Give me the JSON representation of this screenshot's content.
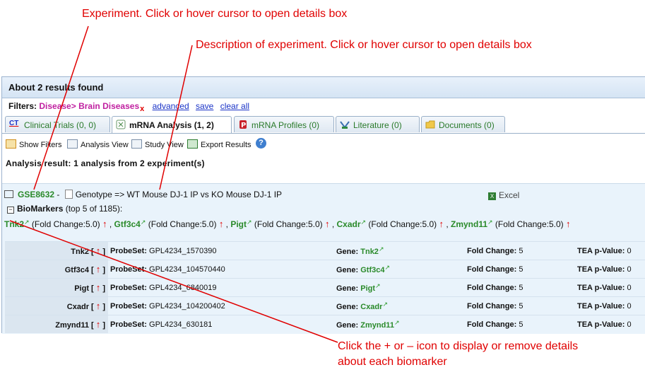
{
  "annotations": {
    "experiment": "Experiment.  Click or hover cursor to open details box",
    "description": "Description of experiment.  Click or hover cursor to open details box",
    "icon_line1": "Click the + or – icon to display or remove details",
    "icon_line2": "about each biomarker"
  },
  "results": {
    "title": "About 2 results found"
  },
  "filters": {
    "label": "Filters:",
    "value": "Disease> Brain Diseases",
    "remove": "x",
    "advanced": "advanced",
    "save": "save",
    "clear_all": "clear all"
  },
  "tabs": [
    {
      "icon": "CT",
      "label": "Clinical Trials (0, 0)"
    },
    {
      "icon": "mrna",
      "label": "mRNA Analysis (1, 2)"
    },
    {
      "icon": "P",
      "label": "mRNA Profiles (0)"
    },
    {
      "icon": "lit",
      "label": "Literature (0)"
    },
    {
      "icon": "doc",
      "label": "Documents (0)"
    }
  ],
  "toolbar": {
    "show_filters": "Show Filters",
    "analysis_view": "Analysis View",
    "study_view": "Study View",
    "export_results": "Export Results",
    "help": "?"
  },
  "analysis_result": "Analysis result:  1 analysis  from 2 experiment(s)",
  "experiment": {
    "id": "GSE8632",
    "sep": " - ",
    "description": "Genotype => WT Mouse DJ-1 IP vs KO Mouse DJ-1 IP",
    "excel": "Excel"
  },
  "biomarkers": {
    "title": "BioMarkers",
    "subtitle": "(top 5 of 1185):",
    "fold_label": "(Fold Change:5.0)",
    "items": [
      {
        "gene": "Tnk2",
        "probeset": "GPL4234_1570390",
        "fold": "5",
        "tea": "0"
      },
      {
        "gene": "Gtf3c4",
        "probeset": "GPL4234_104570440",
        "fold": "5",
        "tea": "0"
      },
      {
        "gene": "Pigt",
        "probeset": "GPL4234_6840019",
        "fold": "5",
        "tea": "0"
      },
      {
        "gene": "Cxadr",
        "probeset": "GPL4234_104200402",
        "fold": "5",
        "tea": "0"
      },
      {
        "gene": "Zmynd11",
        "probeset": "GPL4234_630181",
        "fold": "5",
        "tea": "0"
      }
    ],
    "labels": {
      "probeset": "ProbeSet:",
      "gene": "Gene:",
      "fold": "Fold Change:",
      "tea": "TEA p-Value:"
    }
  },
  "colors": {
    "annotation": "#e00000",
    "gene": "#2a8a2a",
    "filter_value": "#c020a0",
    "link": "#1a33c7"
  }
}
